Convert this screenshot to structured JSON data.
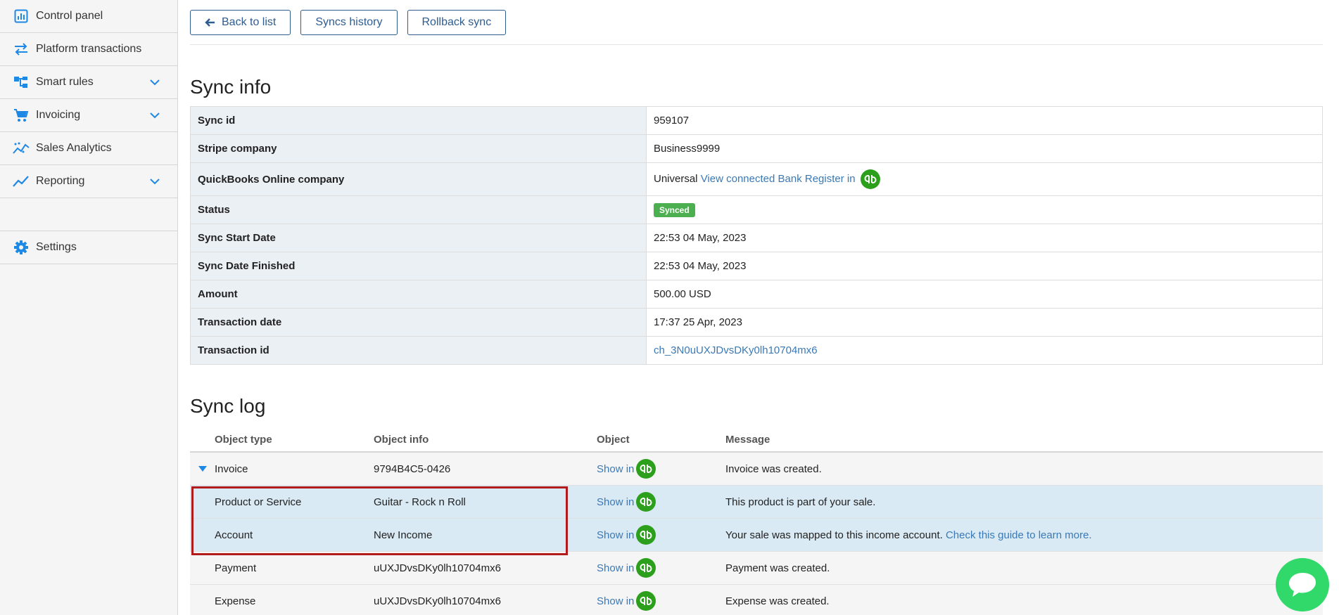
{
  "sidebar": {
    "items": [
      {
        "label": "Control panel",
        "icon": "control-panel-icon"
      },
      {
        "label": "Platform transactions",
        "icon": "transactions-icon"
      },
      {
        "label": "Smart rules",
        "icon": "smart-rules-icon"
      },
      {
        "label": "Invoicing",
        "icon": "cart-icon"
      },
      {
        "label": "Sales Analytics",
        "icon": "analytics-icon"
      },
      {
        "label": "Reporting",
        "icon": "reporting-icon"
      }
    ],
    "settings": {
      "label": "Settings",
      "icon": "gear-icon"
    }
  },
  "toolbar": {
    "back_label": "Back to list",
    "history_label": "Syncs history",
    "rollback_label": "Rollback sync"
  },
  "sync_info": {
    "title": "Sync info",
    "rows": {
      "sync_id": {
        "key": "Sync id",
        "value": "959107"
      },
      "stripe": {
        "key": "Stripe company",
        "value": "Business9999"
      },
      "qbo": {
        "key": "QuickBooks Online company",
        "value": "Universal",
        "link": "View connected Bank Register in"
      },
      "status": {
        "key": "Status",
        "value": "Synced"
      },
      "start": {
        "key": "Sync Start Date",
        "value": "22:53 04 May, 2023"
      },
      "finished": {
        "key": "Sync Date Finished",
        "value": "22:53 04 May, 2023"
      },
      "amount": {
        "key": "Amount",
        "value": "500.00 USD"
      },
      "tx_date": {
        "key": "Transaction date",
        "value": "17:37 25 Apr, 2023"
      },
      "tx_id": {
        "key": "Transaction id",
        "value": "ch_3N0uUXJDvsDKy0lh10704mx6"
      }
    }
  },
  "sync_log": {
    "title": "Sync log",
    "headers": {
      "type": "Object type",
      "info": "Object info",
      "object": "Object",
      "message": "Message"
    },
    "rows": [
      {
        "type": "Invoice",
        "info": "9794B4C5-0426",
        "object": "Show in",
        "message": "Invoice was created."
      },
      {
        "type": "Product or Service",
        "info": "Guitar - Rock n Roll",
        "object": "Show in",
        "message": "This product is part of your sale."
      },
      {
        "type": "Account",
        "info": "New Income",
        "object": "Show in",
        "message": "Your sale was mapped to this income account.",
        "link": "Check this guide to learn more."
      },
      {
        "type": "Payment",
        "info": "uUXJDvsDKy0lh10704mx6",
        "object": "Show in",
        "message": "Payment was created."
      },
      {
        "type": "Expense",
        "info": "uUXJDvsDKy0lh10704mx6",
        "object": "Show in",
        "message": "Expense was created."
      }
    ]
  },
  "colors": {
    "accent": "#3a79b6",
    "badge": "#4caf50",
    "qb": "#2ca01c",
    "highlight": "#b11b1b",
    "chat": "#31d86a"
  }
}
